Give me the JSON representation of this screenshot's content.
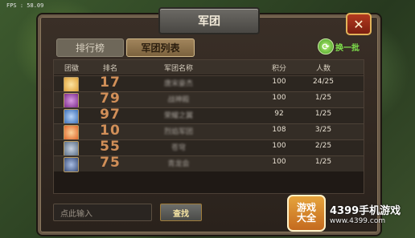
{
  "hud": {
    "fps": "FPS : 58.09"
  },
  "dialog": {
    "title": "军团",
    "close": "✕",
    "tabs": [
      {
        "label": "排行榜"
      },
      {
        "label": "军团列表"
      }
    ],
    "refresh_label": "换一批"
  },
  "table": {
    "headers": [
      "团徽",
      "排名",
      "军团名称",
      "积分",
      "人数"
    ],
    "rows": [
      {
        "emblem": "emblem-1",
        "color": "#e0a23a",
        "rank": "17",
        "name": "唐宋豪杰",
        "score": "100",
        "members": "24/25"
      },
      {
        "emblem": "emblem-2",
        "color": "#7d2b8c",
        "rank": "79",
        "name": "战神殿",
        "score": "100",
        "members": "1/25"
      },
      {
        "emblem": "emblem-3",
        "color": "#3b6fb8",
        "rank": "97",
        "name": "荣耀之翼",
        "score": "92",
        "members": "1/25"
      },
      {
        "emblem": "emblem-4",
        "color": "#e0662a",
        "rank": "10",
        "name": "烈焰军团",
        "score": "108",
        "members": "3/25"
      },
      {
        "emblem": "emblem-5",
        "color": "#5a6f88",
        "rank": "55",
        "name": "苍穹",
        "score": "100",
        "members": "2/25"
      },
      {
        "emblem": "emblem-6",
        "color": "#3a4e7a",
        "rank": "75",
        "name": "青龙会",
        "score": "100",
        "members": "1/25"
      }
    ]
  },
  "search": {
    "placeholder": "点此输入",
    "button": "查找"
  },
  "watermark": {
    "logo_line1": "游戏",
    "logo_line2": "大全",
    "title": "4399手机游戏",
    "url": "www.4399.com"
  }
}
